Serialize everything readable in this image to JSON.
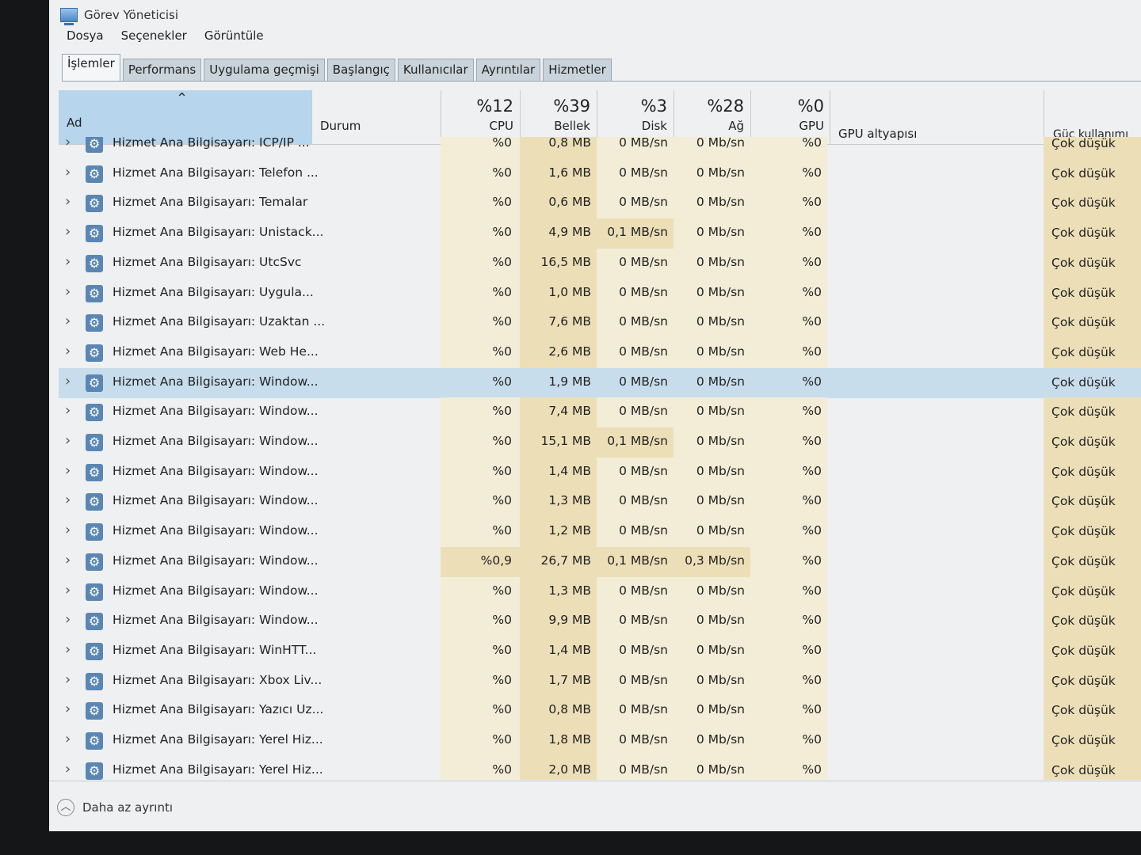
{
  "window": {
    "title": "Görev Yöneticisi"
  },
  "menu": [
    "Dosya",
    "Seçenekler",
    "Görüntüle"
  ],
  "tabs": [
    "İşlemler",
    "Performans",
    "Uygulama geçmişi",
    "Başlangıç",
    "Kullanıcılar",
    "Ayrıntılar",
    "Hizmetler"
  ],
  "active_tab": "İşlemler",
  "columns": {
    "name": "Ad",
    "status": "Durum",
    "cpu": {
      "pct": "%12",
      "label": "CPU"
    },
    "memory": {
      "pct": "%39",
      "label": "Bellek"
    },
    "disk": {
      "pct": "%3",
      "label": "Disk"
    },
    "network": {
      "pct": "%28",
      "label": "Ağ"
    },
    "gpu": {
      "pct": "%0",
      "label": "GPU"
    },
    "gpu_engine": "GPU altyapısı",
    "power": "Güç kullanımı"
  },
  "rows": [
    {
      "name": "Hizmet Ana Bilgisayarı: ICP/IP ...",
      "cpu": "%0",
      "mem": "0,8 MB",
      "disk": "0 MB/sn",
      "net": "0 Mb/sn",
      "gpu": "%0",
      "power": "Çok düşük"
    },
    {
      "name": "Hizmet Ana Bilgisayarı: Telefon ...",
      "cpu": "%0",
      "mem": "1,6 MB",
      "disk": "0 MB/sn",
      "net": "0 Mb/sn",
      "gpu": "%0",
      "power": "Çok düşük"
    },
    {
      "name": "Hizmet Ana Bilgisayarı: Temalar",
      "cpu": "%0",
      "mem": "0,6 MB",
      "disk": "0 MB/sn",
      "net": "0 Mb/sn",
      "gpu": "%0",
      "power": "Çok düşük"
    },
    {
      "name": "Hizmet Ana Bilgisayarı: Unistack...",
      "cpu": "%0",
      "mem": "4,9 MB",
      "disk": "0,1 MB/sn",
      "net": "0 Mb/sn",
      "gpu": "%0",
      "power": "Çok düşük"
    },
    {
      "name": "Hizmet Ana Bilgisayarı: UtcSvc",
      "cpu": "%0",
      "mem": "16,5 MB",
      "disk": "0 MB/sn",
      "net": "0 Mb/sn",
      "gpu": "%0",
      "power": "Çok düşük"
    },
    {
      "name": "Hizmet Ana Bilgisayarı: Uygula...",
      "cpu": "%0",
      "mem": "1,0 MB",
      "disk": "0 MB/sn",
      "net": "0 Mb/sn",
      "gpu": "%0",
      "power": "Çok düşük"
    },
    {
      "name": "Hizmet Ana Bilgisayarı: Uzaktan ...",
      "cpu": "%0",
      "mem": "7,6 MB",
      "disk": "0 MB/sn",
      "net": "0 Mb/sn",
      "gpu": "%0",
      "power": "Çok düşük"
    },
    {
      "name": "Hizmet Ana Bilgisayarı: Web He...",
      "cpu": "%0",
      "mem": "2,6 MB",
      "disk": "0 MB/sn",
      "net": "0 Mb/sn",
      "gpu": "%0",
      "power": "Çok düşük"
    },
    {
      "name": "Hizmet Ana Bilgisayarı: Window...",
      "cpu": "%0",
      "mem": "1,9 MB",
      "disk": "0 MB/sn",
      "net": "0 Mb/sn",
      "gpu": "%0",
      "power": "Çok düşük",
      "selected": true
    },
    {
      "name": "Hizmet Ana Bilgisayarı: Window...",
      "cpu": "%0",
      "mem": "7,4 MB",
      "disk": "0 MB/sn",
      "net": "0 Mb/sn",
      "gpu": "%0",
      "power": "Çok düşük"
    },
    {
      "name": "Hizmet Ana Bilgisayarı: Window...",
      "cpu": "%0",
      "mem": "15,1 MB",
      "disk": "0,1 MB/sn",
      "net": "0 Mb/sn",
      "gpu": "%0",
      "power": "Çok düşük"
    },
    {
      "name": "Hizmet Ana Bilgisayarı: Window...",
      "cpu": "%0",
      "mem": "1,4 MB",
      "disk": "0 MB/sn",
      "net": "0 Mb/sn",
      "gpu": "%0",
      "power": "Çok düşük"
    },
    {
      "name": "Hizmet Ana Bilgisayarı: Window...",
      "cpu": "%0",
      "mem": "1,3 MB",
      "disk": "0 MB/sn",
      "net": "0 Mb/sn",
      "gpu": "%0",
      "power": "Çok düşük"
    },
    {
      "name": "Hizmet Ana Bilgisayarı: Window...",
      "cpu": "%0",
      "mem": "1,2 MB",
      "disk": "0 MB/sn",
      "net": "0 Mb/sn",
      "gpu": "%0",
      "power": "Çok düşük"
    },
    {
      "name": "Hizmet Ana Bilgisayarı: Window...",
      "cpu": "%0,9",
      "mem": "26,7 MB",
      "disk": "0,1 MB/sn",
      "net": "0,3 Mb/sn",
      "gpu": "%0",
      "power": "Çok düşük"
    },
    {
      "name": "Hizmet Ana Bilgisayarı: Window...",
      "cpu": "%0",
      "mem": "1,3 MB",
      "disk": "0 MB/sn",
      "net": "0 Mb/sn",
      "gpu": "%0",
      "power": "Çok düşük"
    },
    {
      "name": "Hizmet Ana Bilgisayarı: Window...",
      "cpu": "%0",
      "mem": "9,9 MB",
      "disk": "0 MB/sn",
      "net": "0 Mb/sn",
      "gpu": "%0",
      "power": "Çok düşük"
    },
    {
      "name": "Hizmet Ana Bilgisayarı: WinHTT...",
      "cpu": "%0",
      "mem": "1,4 MB",
      "disk": "0 MB/sn",
      "net": "0 Mb/sn",
      "gpu": "%0",
      "power": "Çok düşük"
    },
    {
      "name": "Hizmet Ana Bilgisayarı: Xbox Liv...",
      "cpu": "%0",
      "mem": "1,7 MB",
      "disk": "0 MB/sn",
      "net": "0 Mb/sn",
      "gpu": "%0",
      "power": "Çok düşük"
    },
    {
      "name": "Hizmet Ana Bilgisayarı: Yazıcı Uz...",
      "cpu": "%0",
      "mem": "0,8 MB",
      "disk": "0 MB/sn",
      "net": "0 Mb/sn",
      "gpu": "%0",
      "power": "Çok düşük"
    },
    {
      "name": "Hizmet Ana Bilgisayarı: Yerel Hiz...",
      "cpu": "%0",
      "mem": "1,8 MB",
      "disk": "0 MB/sn",
      "net": "0 Mb/sn",
      "gpu": "%0",
      "power": "Çok düşük"
    },
    {
      "name": "Hizmet Ana Bilgisayarı: Yerel Hiz...",
      "cpu": "%0",
      "mem": "2,0 MB",
      "disk": "0 MB/sn",
      "net": "0 Mb/sn",
      "gpu": "%0",
      "power": "Çok düşük"
    }
  ],
  "footer": {
    "fewer_details": "Daha az ayrıntı"
  },
  "colors": {
    "heat_light": "#f3ecd6",
    "heat_medium": "#ecdfb8",
    "selection": "#c8ddec",
    "name_header": "#b7d5ec",
    "power_bg": "#ecdfb8"
  }
}
